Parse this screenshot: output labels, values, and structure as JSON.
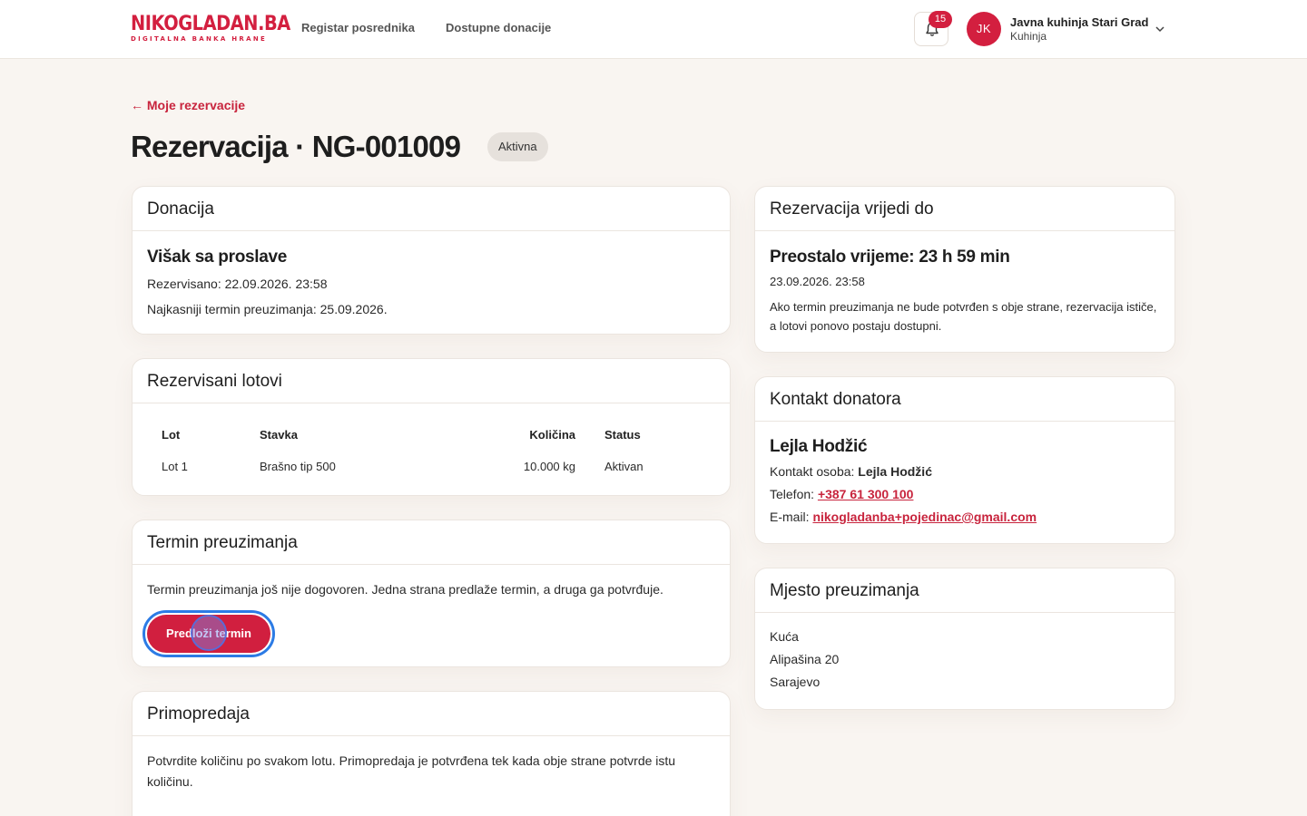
{
  "header": {
    "logo_main_red": "NIKO",
    "logo_main_dark": "GLADAN.BA",
    "logo_sub": "DIGITALNA BANKA HRANE",
    "nav": [
      "Registar posrednika",
      "Dostupne donacije"
    ],
    "notifications_count": "15",
    "user_initials": "JK",
    "user_name": "Javna kuhinja Stari Grad",
    "user_role": "Kuhinja"
  },
  "page": {
    "back_link": "← Moje rezervacije",
    "title": "Rezervacija · NG-001009",
    "status": "Aktivna"
  },
  "donacija": {
    "title": "Donacija",
    "name": "Višak sa proslave",
    "reserved": "Rezervisano: 22.09.2026. 23:58",
    "latest_pickup": "Najkasniji termin preuzimanja: 25.09.2026."
  },
  "lotovi": {
    "title": "Rezervisani lotovi",
    "columns": [
      "Lot",
      "Stavka",
      "Količina",
      "Status"
    ],
    "rows": [
      [
        "Lot 1",
        "Brašno tip 500",
        "10.000 kg",
        "Aktivan"
      ]
    ]
  },
  "termin": {
    "title": "Termin preuzimanja",
    "text": "Termin preuzimanja još nije dogovoren. Jedna strana predlaže termin, a druga ga potvrđuje.",
    "button": "Predloži termin"
  },
  "primopredaja": {
    "title": "Primopredaja",
    "text": "Potvrdite količinu po svakom lotu. Primopredaja je potvrđena tek kada obje strane potvrde istu količinu."
  },
  "vrijedi": {
    "title": "Rezervacija vrijedi do",
    "remaining": "Preostalo vrijeme: 23 h 59 min",
    "until": "23.09.2026. 23:58",
    "note": "Ako termin preuzimanja ne bude potvrđen s obje strane, rezervacija ističe, a lotovi ponovo postaju dostupni."
  },
  "kontakt": {
    "title": "Kontakt donatora",
    "name": "Lejla Hodžić",
    "person_label": "Kontakt osoba:",
    "person": "Lejla Hodžić",
    "phone_label": "Telefon:",
    "phone": "+387 61 300 100",
    "email_label": "E-mail:",
    "email": "nikogladanba+pojedinac@gmail.com"
  },
  "mjesto": {
    "title": "Mjesto preuzimanja",
    "lines": [
      "Kuća",
      "Alipašina 20",
      "Sarajevo"
    ]
  },
  "colors": {
    "brand": "#d31f3f",
    "background": "#f9f5f1",
    "focus": "#2c7be5"
  }
}
